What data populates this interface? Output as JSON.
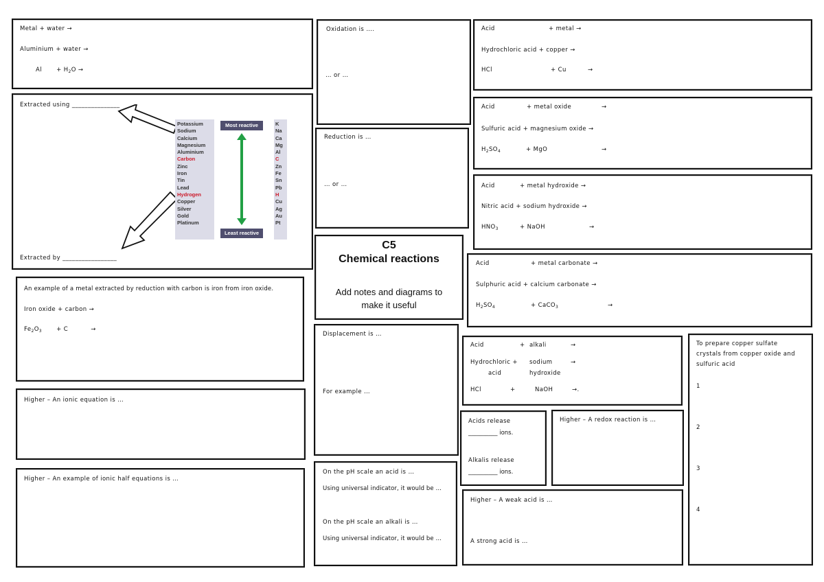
{
  "page": {
    "title_code": "C5",
    "title": "Chemical reactions",
    "subtitle_line1": "Add notes and diagrams to",
    "subtitle_line2": "make it useful"
  },
  "metal_water": {
    "line1": "Metal        + water  →",
    "line2": "Aluminium + water →",
    "line3_a": "Al",
    "line3_b": "+  H",
    "line3_sub": "2",
    "line3_c": "O  →"
  },
  "extraction": {
    "using_label": "Extracted using _______________",
    "by_label": "Extracted by _________________",
    "most_reactive": "Most reactive",
    "least_reactive": "Least reactive",
    "colors": {
      "highlight": "#cc1a2a",
      "arrow": "#22a045",
      "label_bg": "#4f4e6e",
      "table_bg": "#dcdce8"
    },
    "metals": [
      {
        "name": "Potassium",
        "symbol": "K",
        "highlight": false
      },
      {
        "name": "Sodium",
        "symbol": "Na",
        "highlight": false
      },
      {
        "name": "Calcium",
        "symbol": "Ca",
        "highlight": false
      },
      {
        "name": "Magnesium",
        "symbol": "Mg",
        "highlight": false
      },
      {
        "name": "Aluminium",
        "symbol": "Al",
        "highlight": false
      },
      {
        "name": "Carbon",
        "symbol": "C",
        "highlight": true
      },
      {
        "name": "Zinc",
        "symbol": "Zn",
        "highlight": false
      },
      {
        "name": "Iron",
        "symbol": "Fe",
        "highlight": false
      },
      {
        "name": "Tin",
        "symbol": "Sn",
        "highlight": false
      },
      {
        "name": "Lead",
        "symbol": "Pb",
        "highlight": false
      },
      {
        "name": "Hydrogen",
        "symbol": "H",
        "highlight": true
      },
      {
        "name": "Copper",
        "symbol": "Cu",
        "highlight": false
      },
      {
        "name": "Silver",
        "symbol": "Ag",
        "highlight": false
      },
      {
        "name": "Gold",
        "symbol": "Au",
        "highlight": false
      },
      {
        "name": "Platinum",
        "symbol": "Pt",
        "highlight": false
      }
    ]
  },
  "iron_example": {
    "line1": "An example of a metal extracted by reduction with carbon is iron from iron oxide.",
    "line2": "Iron oxide + carbon →",
    "line3_a": "Fe",
    "line3_sub1": "2",
    "line3_b": "O",
    "line3_sub2": "3",
    "line3_c": "+ C",
    "line3_d": "→"
  },
  "ionic_equation": {
    "line1": "Higher – An ionic equation is …"
  },
  "half_equations": {
    "line1": "Higher – An example of ionic half equations is …"
  },
  "oxidation": {
    "line1": "Oxidation is ….",
    "line2": "… or …"
  },
  "reduction": {
    "line1": "Reduction is …",
    "line2": "… or …"
  },
  "displacement": {
    "line1": "Displacement is …",
    "line2": "For example …"
  },
  "ph": {
    "line1": "On the pH scale an acid is …",
    "line2": "Using universal indicator, it would be …",
    "line3": "On the pH scale an alkali is …",
    "line4": "Using universal indicator, it would be …"
  },
  "acid_metal": {
    "r1": [
      "Acid",
      "+ metal  →"
    ],
    "r2": "Hydrochloric acid +  copper →",
    "r3": [
      "HCl",
      "+ Cu",
      "→"
    ]
  },
  "acid_oxide": {
    "r1": [
      "Acid",
      "+ metal oxide",
      "→"
    ],
    "r2": "Sulfuric acid +  magnesium oxide →",
    "r3_a": "H",
    "r3_sub1": "2",
    "r3_b": "SO",
    "r3_sub2": "4",
    "r3_c": "+ MgO",
    "r3_d": "→"
  },
  "acid_hydroxide": {
    "r1": [
      "Acid",
      "+ metal hydroxide →"
    ],
    "r2": "Nitric acid + sodium hydroxide →",
    "r3_a": "HNO",
    "r3_sub": "3",
    "r3_b": "+ NaOH",
    "r3_c": "→"
  },
  "acid_carbonate": {
    "r1": [
      "Acid",
      "+ metal carbonate   →"
    ],
    "r2": "Sulphuric acid +  calcium carbonate →",
    "r3_a": "H",
    "r3_sub1": "2",
    "r3_b": "SO",
    "r3_sub2": "4",
    "r3_c": "+   CaCO",
    "r3_sub3": "3",
    "r3_d": "→"
  },
  "acid_alkali": {
    "r1": [
      "Acid",
      "+",
      "alkali",
      "→"
    ],
    "r2": [
      "Hydrochloric +",
      "sodium",
      "→"
    ],
    "r2b": [
      "acid",
      "hydroxide"
    ],
    "r3": [
      "HCl",
      "+",
      "NaOH",
      "→."
    ]
  },
  "ions": {
    "acids_line1": "Acids release",
    "acids_line2": "__________ ions.",
    "alkalis_line1": "Alkalis release",
    "alkalis_line2": "__________ ions."
  },
  "redox": {
    "line1": "Higher – A redox reaction is …"
  },
  "weak_acid": {
    "line1": "Higher – A weak acid is …",
    "line2": "A strong acid is …"
  },
  "copper_sulfate": {
    "line1": "To prepare copper sulfate",
    "line2": "crystals from copper oxide and",
    "line3": "sulfuric acid",
    "steps": [
      "1",
      "2",
      "3",
      "4"
    ]
  }
}
